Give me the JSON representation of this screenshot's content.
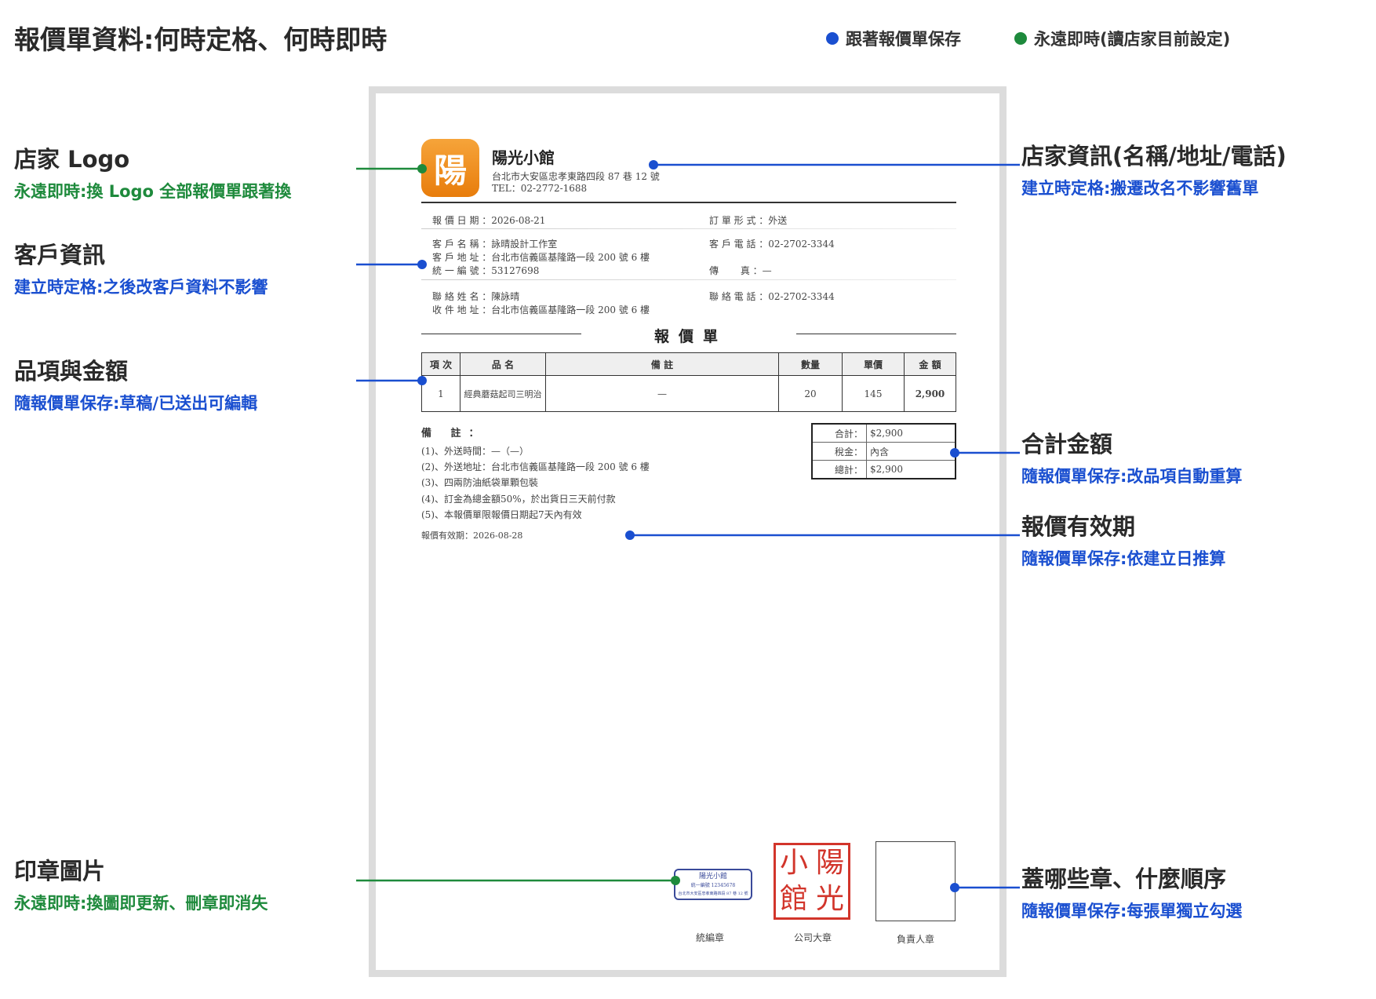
{
  "header": {
    "title": "報價單資料:何時定格、何時即時",
    "legend": [
      {
        "label": "跟著報價單保存",
        "color": "#1a4fd0"
      },
      {
        "label": "永遠即時(讀店家目前設定)",
        "color": "#1e8a3c"
      }
    ]
  },
  "annotations": {
    "logo": {
      "title": "店家 Logo",
      "subtitle": "永遠即時:換 Logo 全部報價單跟著換"
    },
    "customer": {
      "title": "客戶資訊",
      "subtitle": "建立時定格:之後改客戶資料不影響"
    },
    "items": {
      "title": "品項與金額",
      "subtitle": "隨報價單保存:草稿/已送出可編輯"
    },
    "stamp_image": {
      "title": "印章圖片",
      "subtitle": "永遠即時:換圖即更新、刪章即消失"
    },
    "shop_info": {
      "title": "店家資訊(名稱/地址/電話)",
      "subtitle": "建立時定格:搬遷改名不影響舊單"
    },
    "totals": {
      "title": "合計金額",
      "subtitle": "隨報價單保存:改品項自動重算"
    },
    "validity": {
      "title": "報價有效期",
      "subtitle": "隨報價單保存:依建立日推算"
    },
    "stamps": {
      "title": "蓋哪些章、什麼順序",
      "subtitle": "隨報價單保存:每張單獨立勾選"
    }
  },
  "quote": {
    "logo_char": "陽",
    "shop_name": "陽光小館",
    "shop_address": "台北市大安區忠孝東路四段 87 巷 12 號",
    "shop_tel": "TEL：02-2772-1688",
    "quote_date_label": "報 價 日 期 ：2026-08-21",
    "order_type_label": "訂 單 形 式 ：外送",
    "customer_name": "客 戶 名 稱 ：詠晴設計工作室",
    "customer_phone": "客 戶 電 話 ：02-2702-3344",
    "customer_address": "客 戶 地 址 ：台北市信義區基隆路一段 200 號 6 樓",
    "tax_id": "統 一 編 號 ：53127698",
    "fax": "傳　　 真 ：—",
    "contact_name": "聯 絡 姓 名 ：陳詠晴",
    "contact_phone": "聯 絡 電 話 ：02-2702-3344",
    "recipient_address": "收 件 地 址 ：台北市信義區基隆路一段 200 號 6 樓",
    "doc_title": "報價單",
    "table_headers": [
      "項 次",
      "品 名",
      "備 註",
      "數量",
      "單價",
      "金 額"
    ],
    "rows": [
      {
        "no": "1",
        "name": "經典蘑菇起司三明治",
        "note": "—",
        "qty": "20",
        "price": "145",
        "amount": "2,900"
      }
    ],
    "notes_title": "備 註：",
    "notes": [
      "(1)、外送時間：—（—）",
      "(2)、外送地址：台北市信義區基隆路一段 200 號 6 樓",
      "(3)、四兩防油紙袋單顆包裝",
      "(4)、訂金為總金額50%，於出貨日三天前付款",
      "(5)、本報價單限報價日期起7天內有效"
    ],
    "validity": "報價有效期：2026-08-28",
    "totals": [
      {
        "label": "合計：",
        "value": "$2,900"
      },
      {
        "label": "稅金：",
        "value": "內含"
      },
      {
        "label": "總計：",
        "value": "$2,900"
      }
    ],
    "stamp_small_lines": [
      "陽光小館",
      "統一編號 12345678",
      "台北市大安區忠孝東路四段 87 巷 12 號"
    ],
    "company_stamp_chars": [
      "小",
      "陽",
      "館",
      "光"
    ],
    "stamp_labels": [
      "統編章",
      "公司大章",
      "負責人章"
    ]
  }
}
